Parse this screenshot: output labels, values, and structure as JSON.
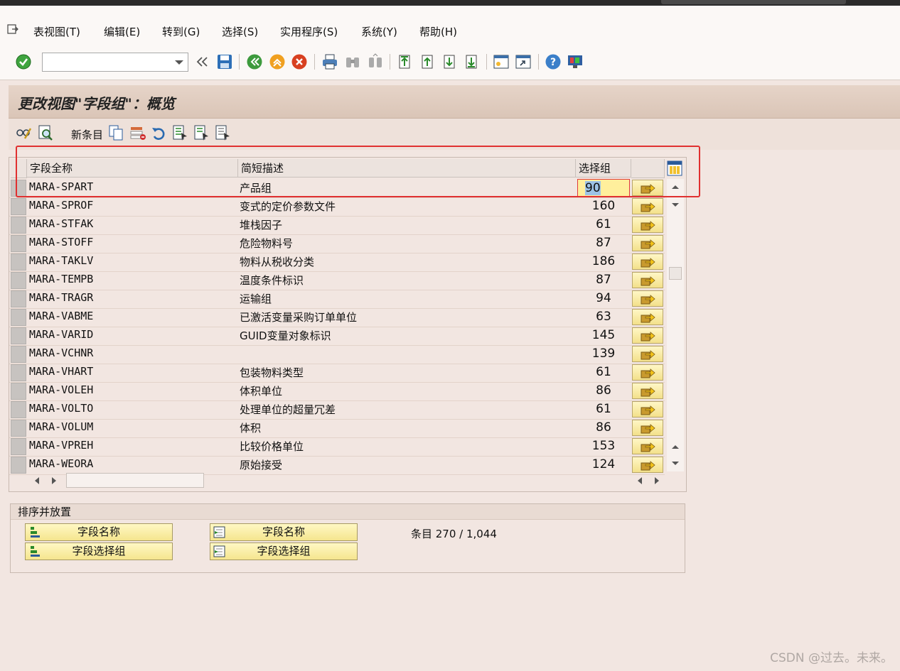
{
  "menu": [
    "表视图(T)",
    "编辑(E)",
    "转到(G)",
    "选择(S)",
    "实用程序(S)",
    "系统(Y)",
    "帮助(H)"
  ],
  "command_field": {
    "value": ""
  },
  "page_title": "更改视图\"字段组\"：概览",
  "app_toolbar": {
    "new_entries": "新条目"
  },
  "table": {
    "headers": [
      "字段全称",
      "简短描述",
      "选择组"
    ],
    "rows": [
      {
        "field": "MARA-SPART",
        "desc": "产品组",
        "group": "90"
      },
      {
        "field": "MARA-SPROF",
        "desc": "变式的定价参数文件",
        "group": "160"
      },
      {
        "field": "MARA-STFAK",
        "desc": "堆栈因子",
        "group": "61"
      },
      {
        "field": "MARA-STOFF",
        "desc": "危险物料号",
        "group": "87"
      },
      {
        "field": "MARA-TAKLV",
        "desc": "物料从税收分类",
        "group": "186"
      },
      {
        "field": "MARA-TEMPB",
        "desc": "温度条件标识",
        "group": "87"
      },
      {
        "field": "MARA-TRAGR",
        "desc": "运输组",
        "group": "94"
      },
      {
        "field": "MARA-VABME",
        "desc": "已激活变量采购订单单位",
        "group": "63"
      },
      {
        "field": "MARA-VARID",
        "desc": "GUID变量对象标识",
        "group": "145"
      },
      {
        "field": "MARA-VCHNR",
        "desc": "",
        "group": "139"
      },
      {
        "field": "MARA-VHART",
        "desc": "包装物料类型",
        "group": "61"
      },
      {
        "field": "MARA-VOLEH",
        "desc": "体积单位",
        "group": "86"
      },
      {
        "field": "MARA-VOLTO",
        "desc": "处理单位的超量冗差",
        "group": "61"
      },
      {
        "field": "MARA-VOLUM",
        "desc": "体积",
        "group": "86"
      },
      {
        "field": "MARA-VPREH",
        "desc": "比较价格单位",
        "group": "153"
      },
      {
        "field": "MARA-WEORA",
        "desc": "原始接受",
        "group": "124"
      }
    ]
  },
  "sort": {
    "title": "排序并放置",
    "buttons": [
      "字段名称",
      "字段选择组",
      "字段名称",
      "字段选择组"
    ],
    "entries": "条目 270 / 1,044"
  },
  "watermark": "CSDN @过去。未来。"
}
